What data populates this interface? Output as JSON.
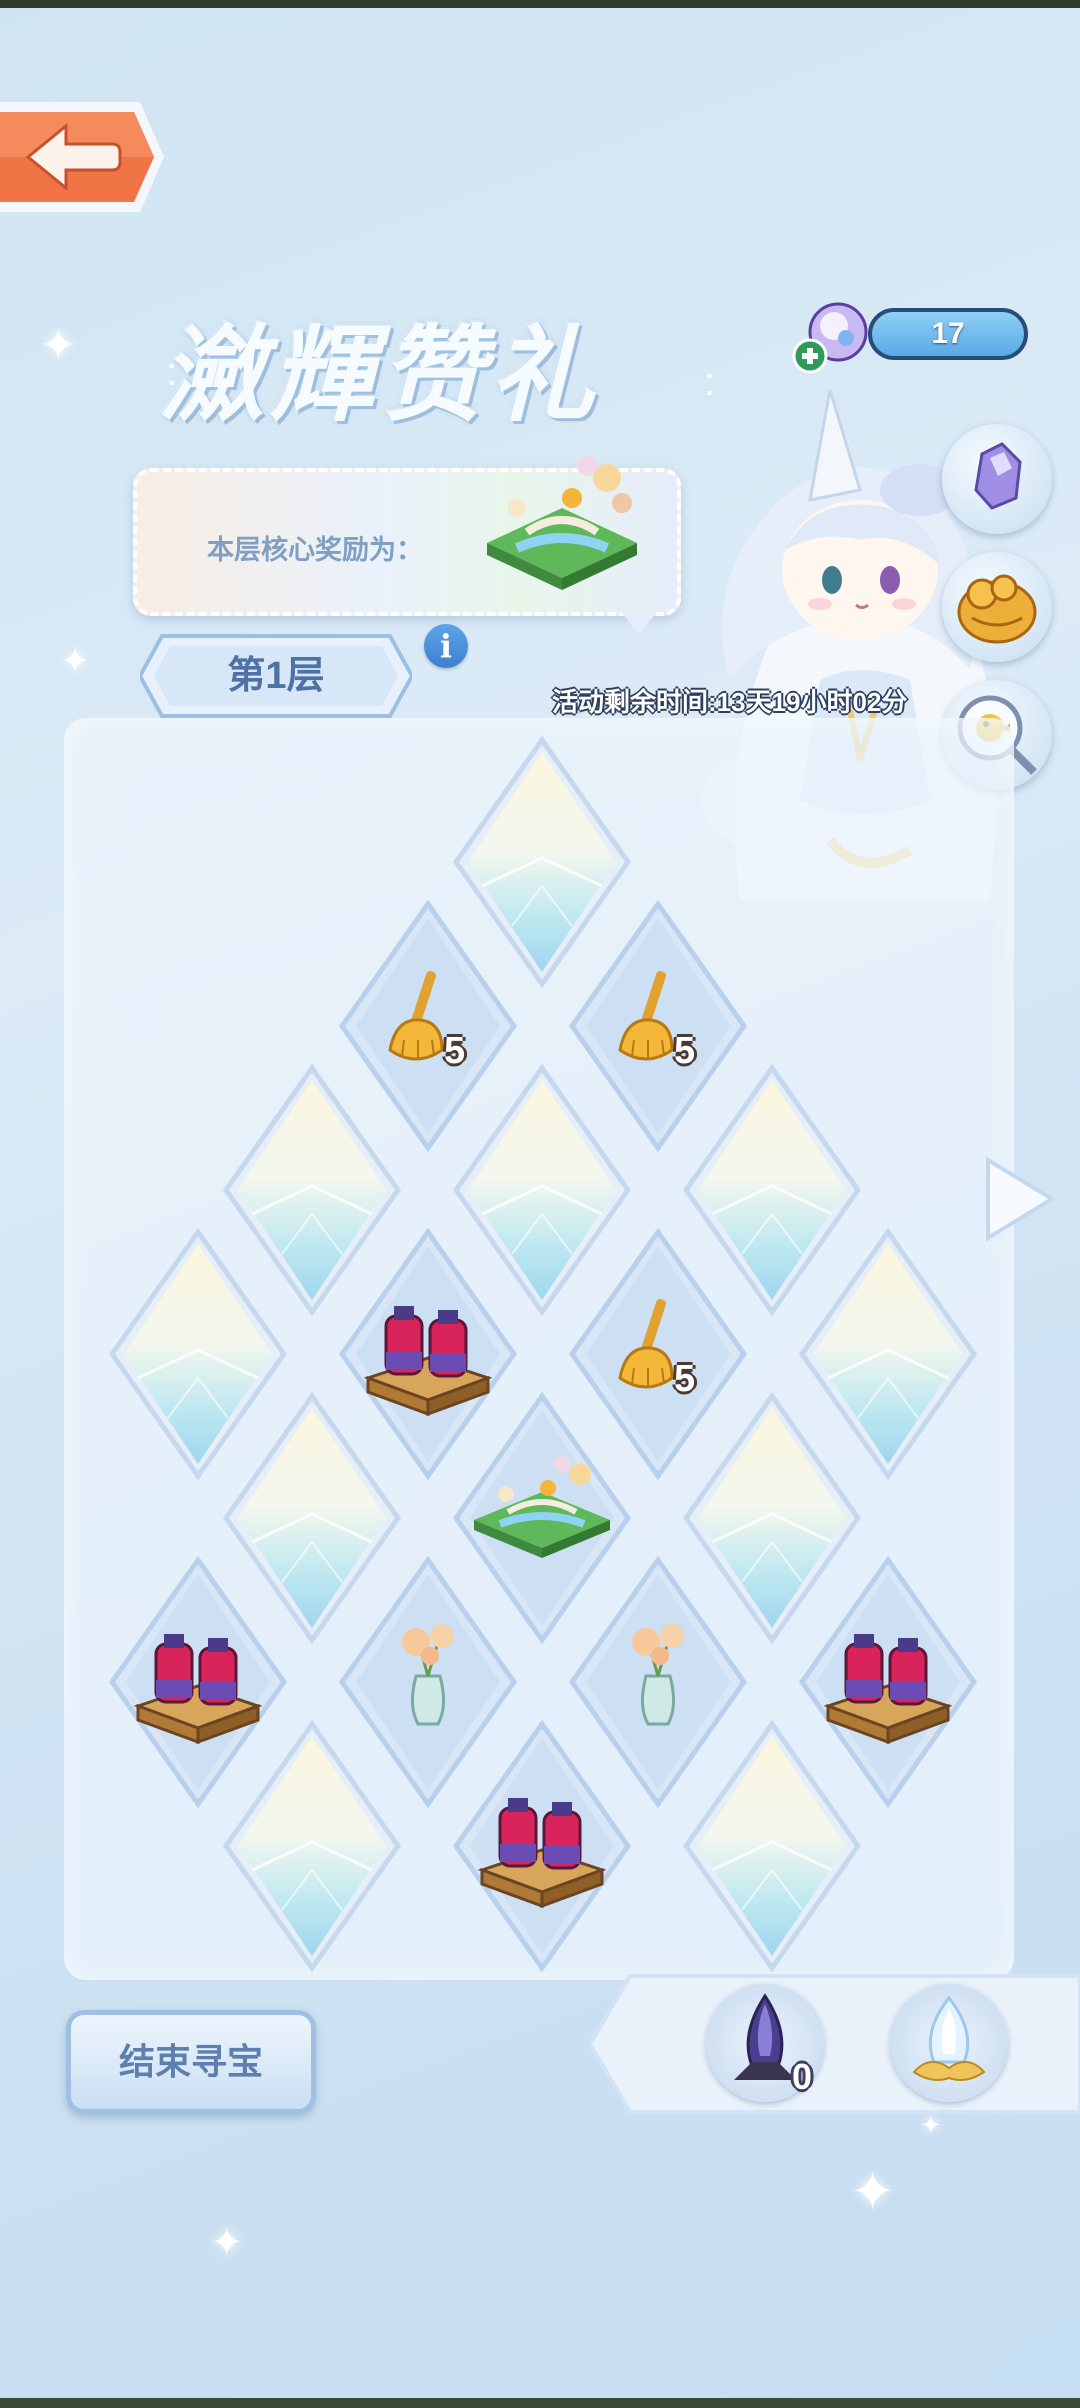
{
  "header": {
    "back_icon": "left-arrow-icon",
    "title": "瀲輝赞礼"
  },
  "currency": {
    "value": "17",
    "icon": "crystal-orb-plus-icon"
  },
  "core_reward": {
    "label": "本层核心奖励为：",
    "item": "garden-bridge-scene"
  },
  "floor": {
    "label": "第1层",
    "info_icon": "i"
  },
  "timer": {
    "text": "活动剩余时间:13天19小时02分"
  },
  "side_buttons": [
    "purple-crystal-icon",
    "golden-lion-icon",
    "duck-magnifier-icon"
  ],
  "grid": {
    "tiles": [
      {
        "id": "r0",
        "item": "crystal"
      },
      {
        "id": "r1a",
        "item": "broom",
        "qty": "5"
      },
      {
        "id": "r1b",
        "item": "broom",
        "qty": "5"
      },
      {
        "id": "r2a",
        "item": "crystal"
      },
      {
        "id": "r2b",
        "item": "crystal"
      },
      {
        "id": "r2c",
        "item": "crystal"
      },
      {
        "id": "r3a",
        "item": "crystal"
      },
      {
        "id": "r3b",
        "item": "potion-crate"
      },
      {
        "id": "r3c",
        "item": "broom",
        "qty": "5"
      },
      {
        "id": "r3d",
        "item": "crystal"
      },
      {
        "id": "r4a",
        "item": "crystal"
      },
      {
        "id": "r4b",
        "item": "garden-scene"
      },
      {
        "id": "r4c",
        "item": "crystal"
      },
      {
        "id": "r5a",
        "item": "potion-crate"
      },
      {
        "id": "r5b",
        "item": "flower-vase"
      },
      {
        "id": "r5c",
        "item": "flower-vase"
      },
      {
        "id": "r5d",
        "item": "potion-crate"
      },
      {
        "id": "r6a",
        "item": "crystal"
      },
      {
        "id": "r6b",
        "item": "potion-crate"
      },
      {
        "id": "r6c",
        "item": "crystal"
      }
    ]
  },
  "footer": {
    "end_button": "结束寻宝",
    "tool_dark_count": "0",
    "tool_dark_icon": "dark-crystal-icon",
    "tool_light_icon": "light-crystal-icon"
  },
  "nav": {
    "next_icon": "right-arrow-icon"
  }
}
